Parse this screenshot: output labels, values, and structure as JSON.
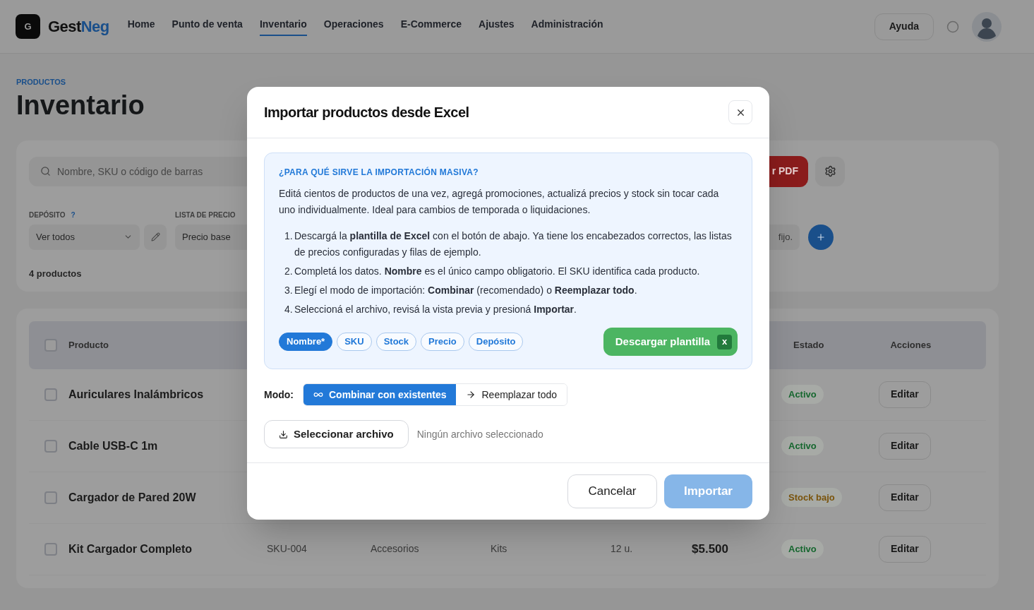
{
  "nav": {
    "logo_letter": "G",
    "brand": "Gest",
    "brand_accent": "Neg",
    "items": [
      {
        "label": "Home",
        "selected": false
      },
      {
        "label": "Punto de venta",
        "selected": false
      },
      {
        "label": "Inventario",
        "selected": true
      },
      {
        "label": "Operaciones",
        "selected": false
      },
      {
        "label": "E-Commerce",
        "selected": false
      },
      {
        "label": "Ajustes",
        "selected": false
      },
      {
        "label": "Administración",
        "selected": false
      }
    ],
    "help_button": "Ayuda"
  },
  "page": {
    "eyebrow": "PRODUCTOS",
    "title": "Inventario"
  },
  "filters": {
    "search_placeholder": "Nombre, SKU o código de barras",
    "pdf_button": "r PDF",
    "deposit_label": "DEPÓSITO",
    "deposit_help": "?",
    "deposit_value": "Ver todos",
    "price_list_label": "LISTA DE PRECIO",
    "price_list_value": "Precio base",
    "extra_field": "fijo.",
    "count": "4 productos"
  },
  "table": {
    "header_checked": false,
    "columns": [
      "Producto",
      "Estado",
      "Acciones"
    ],
    "rows": [
      {
        "checked": false,
        "name": "Auriculares Inalámbricos",
        "status": "Activo",
        "color": "#16672f",
        "action": "Editar"
      },
      {
        "checked": false,
        "name": "Cable USB-C 1m",
        "status": "Activo",
        "color": "#16672f",
        "action": "Editar"
      },
      {
        "checked": false,
        "name": "Cargador de Pared 20W",
        "status": "Stock bajo",
        "color": "#7a540c",
        "action": "Editar"
      },
      {
        "checked": false,
        "name": "Kit Cargador Completo",
        "sku": "SKU-004",
        "category": "Accesorios",
        "subcategory": "Kits",
        "stock": "12 u.",
        "price": "$5.500",
        "status": "Activo",
        "color": "#16672f",
        "action": "Editar"
      }
    ]
  },
  "modal": {
    "title": "Importar productos desde Excel",
    "info": {
      "heading": "¿PARA QUÉ SIRVE LA IMPORTACIÓN MASIVA?",
      "intro": "Editá cientos de productos de una vez, agregá promociones, actualizá precios y stock sin tocar cada uno individualmente. Ideal para cambios de temporada o liquidaciones.",
      "steps": [
        {
          "number": "1.",
          "text": "Descargá la **plantilla de Excel** con el botón de abajo. Ya tiene los encabezados correctos, las listas de precios configuradas y filas de ejemplo."
        },
        {
          "number": "2.",
          "text": "Completá los datos. **Nombre** es el único campo obligatorio. El SKU identifica cada producto."
        },
        {
          "number": "3.",
          "text": "Elegí el modo de importación: **Combinar** (recomendado) o **Reemplazar todo**."
        },
        {
          "number": "4.",
          "text": "Seleccioná el archivo, revisá la vista previa y presioná **Importar**."
        }
      ],
      "fields": [
        {
          "label": "Nombre*",
          "required": true
        },
        {
          "label": "SKU",
          "required": false
        },
        {
          "label": "Stock",
          "required": false
        },
        {
          "label": "Precio",
          "required": false
        },
        {
          "label": "Depósito",
          "required": false
        }
      ],
      "download_button": "Descargar plantilla",
      "excel_badge": "x"
    },
    "mode_label": "Modo:",
    "modes": [
      {
        "label": "Combinar con existentes",
        "kind": "merge",
        "selected": true
      },
      {
        "label": "Reemplazar todo",
        "kind": "replace",
        "selected": false
      }
    ],
    "file_button": "Seleccionar archivo",
    "file_status": "Ningún archivo seleccionado",
    "cancel_button": "Cancelar",
    "import_button": {
      "label": "Importar",
      "disabled": true
    }
  }
}
